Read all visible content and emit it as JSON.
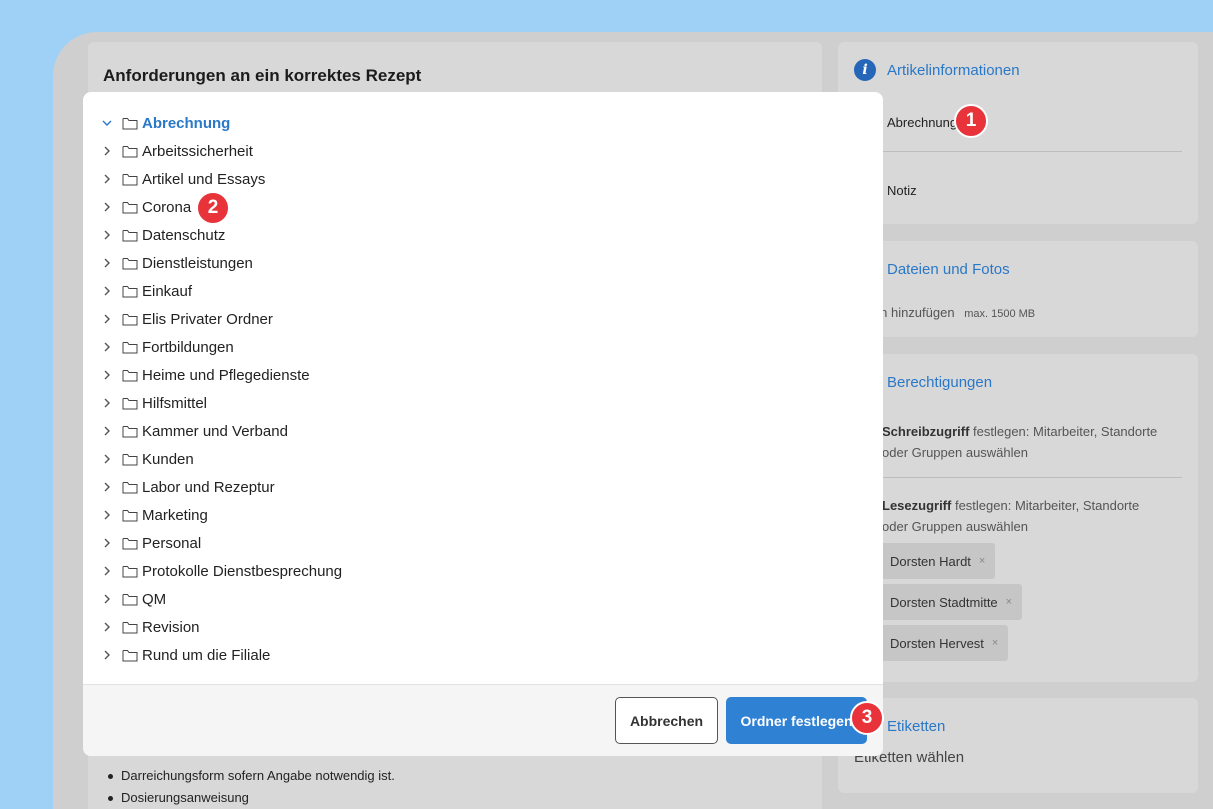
{
  "main": {
    "title": "Anforderungen an ein korrektes Rezept",
    "bullets": [
      "Darreichungsform sofern Angabe notwendig ist.",
      "Dosierungsanweisung"
    ]
  },
  "sidebar": {
    "info": {
      "heading": "Artikelinformationen",
      "folder_value": "Abrechnung",
      "note_label": "Notiz"
    },
    "files": {
      "heading": "Dateien und Fotos",
      "add_text": "ien hinzufügen",
      "max_size": "max. 1500 MB"
    },
    "permissions": {
      "heading": "Berechtigungen",
      "write_bold": "Schreibzugriff",
      "write_rest": " festlegen: Mitarbeiter, Standorte",
      "write_line2": "oder Gruppen auswählen",
      "read_bold": "Lesezugriff",
      "read_rest": " festlegen: Mitarbeiter, Standorte",
      "read_line2": "oder Gruppen auswählen",
      "chips": [
        "Dorsten Hardt",
        "Dorsten Stadtmitte",
        "Dorsten Hervest"
      ],
      "chip_remove": "×"
    },
    "labels": {
      "heading": "Etiketten",
      "choose": "Etiketten wählen"
    }
  },
  "dialog": {
    "folders": [
      {
        "label": "Abrechnung",
        "expanded": true,
        "active": true
      },
      {
        "label": "Arbeitssicherheit"
      },
      {
        "label": "Artikel und Essays"
      },
      {
        "label": "Corona"
      },
      {
        "label": "Datenschutz"
      },
      {
        "label": "Dienstleistungen"
      },
      {
        "label": "Einkauf"
      },
      {
        "label": "Elis Privater Ordner"
      },
      {
        "label": "Fortbildungen"
      },
      {
        "label": "Heime und Pflegedienste"
      },
      {
        "label": "Hilfsmittel"
      },
      {
        "label": "Kammer und Verband"
      },
      {
        "label": "Kunden"
      },
      {
        "label": "Labor und Rezeptur"
      },
      {
        "label": "Marketing"
      },
      {
        "label": "Personal"
      },
      {
        "label": "Protokolle Dienstbesprechung"
      },
      {
        "label": "QM"
      },
      {
        "label": "Revision"
      },
      {
        "label": "Rund um die Filiale"
      }
    ],
    "cancel_label": "Abbrechen",
    "confirm_label": "Ordner festlegen"
  },
  "markers": [
    "1",
    "2",
    "3"
  ],
  "colors": {
    "accent": "#2f81d4",
    "marker": "#e8333a",
    "page_bg": "#9fd0f6"
  }
}
